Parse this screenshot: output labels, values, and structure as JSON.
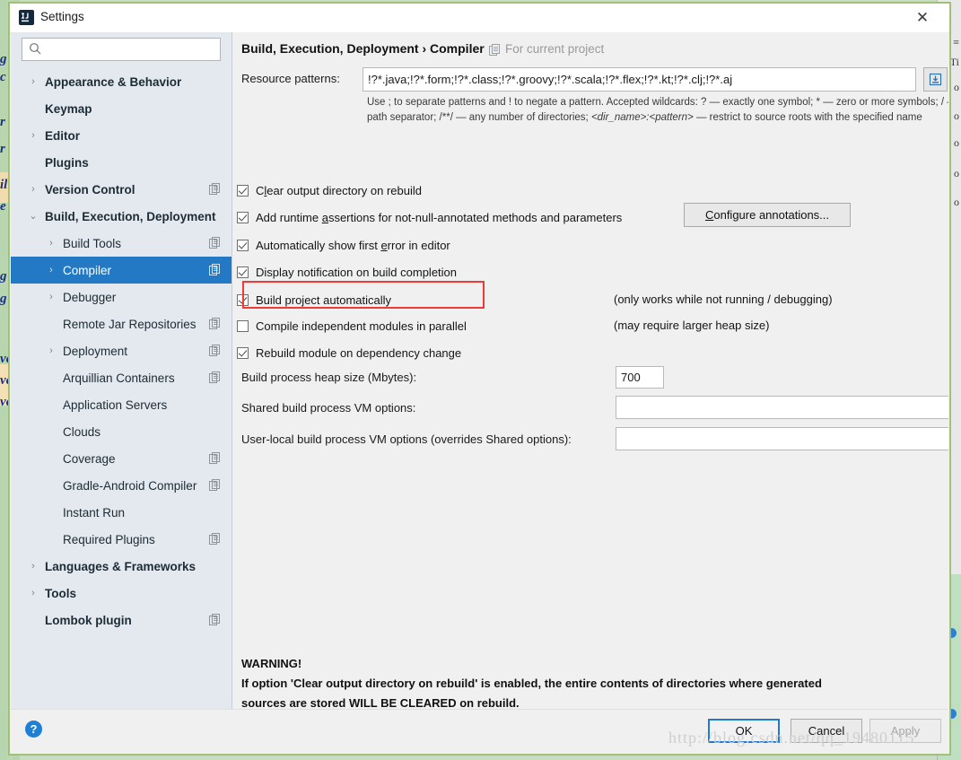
{
  "window": {
    "title": "Settings",
    "app_icon": "intellij-idea-icon",
    "close_icon": "close-icon"
  },
  "search": {
    "value": "",
    "placeholder": "",
    "icon": "search-icon"
  },
  "sidebar": {
    "items": [
      {
        "label": "Appearance & Behavior",
        "level": 0,
        "arrow": "›",
        "scope_icon": false,
        "selected": false
      },
      {
        "label": "Keymap",
        "level": 0,
        "arrow": "",
        "scope_icon": false,
        "selected": false
      },
      {
        "label": "Editor",
        "level": 0,
        "arrow": "›",
        "scope_icon": false,
        "selected": false
      },
      {
        "label": "Plugins",
        "level": 0,
        "arrow": "",
        "scope_icon": false,
        "selected": false
      },
      {
        "label": "Version Control",
        "level": 0,
        "arrow": "›",
        "scope_icon": true,
        "selected": false
      },
      {
        "label": "Build, Execution, Deployment",
        "level": 0,
        "arrow": "⌄",
        "scope_icon": false,
        "selected": false
      },
      {
        "label": "Build Tools",
        "level": 1,
        "arrow": "›",
        "scope_icon": true,
        "selected": false
      },
      {
        "label": "Compiler",
        "level": 1,
        "arrow": "›",
        "scope_icon": true,
        "selected": true
      },
      {
        "label": "Debugger",
        "level": 1,
        "arrow": "›",
        "scope_icon": false,
        "selected": false
      },
      {
        "label": "Remote Jar Repositories",
        "level": 1,
        "arrow": "",
        "scope_icon": true,
        "selected": false
      },
      {
        "label": "Deployment",
        "level": 1,
        "arrow": "›",
        "scope_icon": true,
        "selected": false
      },
      {
        "label": "Arquillian Containers",
        "level": 1,
        "arrow": "",
        "scope_icon": true,
        "selected": false
      },
      {
        "label": "Application Servers",
        "level": 1,
        "arrow": "",
        "scope_icon": false,
        "selected": false
      },
      {
        "label": "Clouds",
        "level": 1,
        "arrow": "",
        "scope_icon": false,
        "selected": false
      },
      {
        "label": "Coverage",
        "level": 1,
        "arrow": "",
        "scope_icon": true,
        "selected": false
      },
      {
        "label": "Gradle-Android Compiler",
        "level": 1,
        "arrow": "",
        "scope_icon": true,
        "selected": false
      },
      {
        "label": "Instant Run",
        "level": 1,
        "arrow": "",
        "scope_icon": false,
        "selected": false
      },
      {
        "label": "Required Plugins",
        "level": 1,
        "arrow": "",
        "scope_icon": true,
        "selected": false
      },
      {
        "label": "Languages & Frameworks",
        "level": 0,
        "arrow": "›",
        "scope_icon": false,
        "selected": false
      },
      {
        "label": "Tools",
        "level": 0,
        "arrow": "›",
        "scope_icon": false,
        "selected": false
      },
      {
        "label": "Lombok plugin",
        "level": 0,
        "arrow": "",
        "scope_icon": true,
        "selected": false
      }
    ],
    "selection_color": "#2379c4"
  },
  "content": {
    "breadcrumb": "Build, Execution, Deployment › Compiler",
    "scope_icon": "project-scope-icon",
    "scope_text": "For current project",
    "resource_patterns": {
      "label": "Resource patterns:",
      "value": "!?*.java;!?*.form;!?*.class;!?*.groovy;!?*.scala;!?*.flex;!?*.kt;!?*.clj;!?*.aj",
      "expand_icon": "expand-editor-icon",
      "hint_line1": "Use ; to separate patterns and ! to negate a pattern. Accepted wildcards: ? — exactly one symbol; * — zero or more",
      "hint_line2a": "symbols; / — path separator; /**/ — any number of directories; ",
      "hint_line2b": "<dir_name>:<pattern>",
      "hint_line2c": " — restrict to source roots",
      "hint_line3": "with the specified name"
    },
    "checkboxes": [
      {
        "label": "Clear output directory on rebuild",
        "checked": true,
        "mnemonic": "l",
        "note": ""
      },
      {
        "label": "Add runtime assertions for not-null-annotated methods and parameters",
        "checked": true,
        "mnemonic": "a",
        "note": ""
      },
      {
        "label": "Automatically show first error in editor",
        "checked": true,
        "mnemonic": "e",
        "note": ""
      },
      {
        "label": "Display notification on build completion",
        "checked": true,
        "mnemonic": "",
        "note": ""
      },
      {
        "label": "Build project automatically",
        "checked": true,
        "mnemonic": "",
        "note": "(only works while not running / debugging)"
      },
      {
        "label": "Compile independent modules in parallel",
        "checked": false,
        "mnemonic": "",
        "note": "(may require larger heap size)"
      },
      {
        "label": "Rebuild module on dependency change",
        "checked": true,
        "mnemonic": "",
        "note": ""
      }
    ],
    "configure_annotations_button": "Configure annotations...",
    "configure_annotations_mnemonic": "C",
    "highlight_color": "#ef3b37",
    "fields": [
      {
        "label": "Build process heap size (Mbytes):",
        "value": "700"
      },
      {
        "label": "Shared build process VM options:",
        "value": ""
      },
      {
        "label": "User-local build process VM options (overrides Shared options):",
        "value": ""
      }
    ],
    "warning": {
      "heading": "WARNING!",
      "line1": "If option 'Clear output directory on rebuild' is enabled, the entire contents of directories where generated",
      "line2": "sources are stored WILL BE CLEARED on rebuild."
    }
  },
  "footer": {
    "help_icon": "help-icon",
    "ok_label": "OK",
    "cancel_label": "Cancel",
    "apply_label": "Apply"
  },
  "watermark": "http://blog.csdn.net/qq_19480115"
}
